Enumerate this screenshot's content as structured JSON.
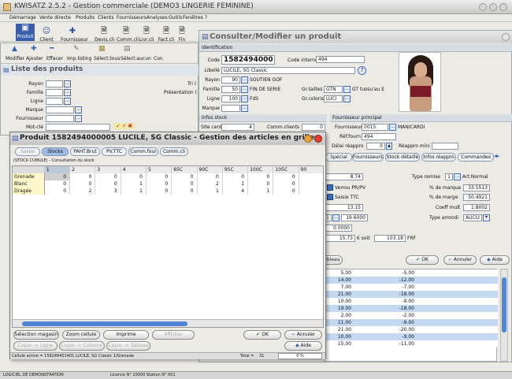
{
  "app": {
    "title": "KWISATZ 2.5.2 - Gestion commerciale (DEMO3 LINGERIE FEMININE)"
  },
  "menu": [
    "Démarrage",
    "Vente directe",
    "Produits",
    "Clients",
    "Fournisseurs",
    "Analyses",
    "Outils",
    "Fenêtres",
    "?"
  ],
  "toolbar": [
    "Produit",
    "Client",
    "Fournisseur",
    "Devis.cli",
    "Comm.cli",
    "Livr.cli",
    "Fact.cli",
    "Fin"
  ],
  "toolbar2": [
    "Modifier",
    "Ajouter",
    "Effacer",
    "Imp.listing",
    "Sélect.tous",
    "Sélect.aucun",
    "Con"
  ],
  "listing": {
    "title": "Liste des produits",
    "filters": [
      "Rayon",
      "Famille",
      "Ligne",
      "Marque",
      "Fournisseur",
      "Mot-clé"
    ],
    "right1": "Tri (",
    "right2": "Présentation ("
  },
  "consult": {
    "title": "Consulter/Modifier un produit",
    "ident_header": "Identification",
    "code_label": "Code",
    "code_value": "1582494000005",
    "code_interne_label": "Code interne",
    "code_interne_value": "494",
    "libelle_label": "Libellé",
    "libelle_value": "LUCILE, SG Classic",
    "rayon_label": "Rayon",
    "rayon_code": "90",
    "rayon_name": "SOUTIEN GOF",
    "famille_label": "Famille",
    "famille_code": "50",
    "famille_name": "FIN DE SERIE",
    "ligne_label": "Ligne",
    "ligne_code": "100",
    "ligne_name": "FdS",
    "marque_label": "Marque",
    "grtailles_label": "Gr.tailles",
    "grtailles_value": "GTN",
    "grtailles_name": "GT tussu'au E",
    "grcolors_label": "Gr.coloris",
    "grcolors_value": "LUCI",
    "stock_header": "Infos stock",
    "stock_central_label": "Site central",
    "stock_central_value": "4",
    "comm_clients_label": "Comm.clients",
    "comm_clients_value": "0",
    "fourn_header": "Fournisseur principal",
    "fourn_label": "Fournisseur",
    "fourn_code": "0015",
    "fourn_name": "MANICARDI",
    "ref_four_label": "Réf.fourn",
    "ref_four_value": "494",
    "delai_label": "Délai réappro",
    "delai_value": "0",
    "reappro_label": "Réappro mini",
    "tabs": [
      "Spécial",
      "Fournisseurs",
      "Stock détaillé",
      "Infos réappro",
      "Commandes"
    ],
    "vals": [
      "8.74",
      "13.15",
      "19.6000",
      "0.0000",
      "15.73",
      "103.18"
    ],
    "verrou_label": "Verrou PR/PV",
    "saisie_ttc_label": "Saisie TTC",
    "qty_one": "1",
    "euro_soit": "€ soit",
    "frf": "FRF",
    "type_remise_label": "Type remise",
    "type_remise_num": "1",
    "type_remise_value": "Art.Normal",
    "marque_pct_label": "% de marque",
    "marque_pct_value": "33.5513",
    "marge_pct_label": "% de marge",
    "marge_pct_value": "50.4921",
    "coeff_label": "Coeff mult",
    "coeff_value": "1.8002",
    "arrondi_label": "Type arrondi",
    "arrondi_value": "AUCUN",
    "tableau_label": "Tableau",
    "ok_label": "OK",
    "annuler_label": "Annuler",
    "aide_label": "Aide",
    "list_rows": [
      [
        "5.00",
        "-5.00"
      ],
      [
        "14.00",
        "-12.00"
      ],
      [
        "7.00",
        "-7.00"
      ],
      [
        "21.00",
        "-18.00"
      ],
      [
        "10.00",
        "-9.00"
      ],
      [
        "19.00",
        "-18.00"
      ],
      [
        "2.00",
        "-2.00"
      ],
      [
        "11.00",
        "-9.00"
      ],
      [
        "21.00",
        "-20.00"
      ],
      [
        "10.00",
        "-9.00"
      ],
      [
        "15.00",
        "-11.00"
      ]
    ]
  },
  "grid": {
    "title": "Produit 1582494000005 LUCILE, SG Classic - Gestion des articles en grilles",
    "tabs": [
      "Saisie",
      "Stocks",
      "PAHT.Brut",
      "PV.TTC",
      "Comm.four",
      "Comm.cli"
    ],
    "caption": "(STOCK CUMULE) - Consultation du stock",
    "columns": [
      "",
      "1",
      "2",
      "3",
      "4",
      "5",
      "85C",
      "90C",
      "95C",
      "100C",
      "105C",
      "90"
    ],
    "rows": [
      {
        "name": "Grenade",
        "vals": [
          "0",
          "0",
          "0",
          "0",
          "0",
          "0",
          "0",
          "0",
          "0",
          "0"
        ]
      },
      {
        "name": "Blanc",
        "vals": [
          "0",
          "0",
          "0",
          "1",
          "0",
          "0",
          "2",
          "1",
          "0",
          "0"
        ]
      },
      {
        "name": "Dragée",
        "vals": [
          "0",
          "2",
          "3",
          "1",
          "0",
          "0",
          "1",
          "4",
          "1",
          "0"
        ]
      }
    ],
    "buttons": [
      "Sélection magasin",
      "Zoom cellule",
      "Imprime",
      "Afficher"
    ],
    "buttons2": [
      "Copie -> Ligne",
      "Copie -> Colonne",
      "Copie -> Tableau"
    ],
    "ok_label": "OK",
    "annuler_label": "Annuler",
    "aide_label": "Aide",
    "status_left": "Cellule active = 158249401401 LUCILE, SG Classic 1/Grenade",
    "total_label": "Total =",
    "total_value": "31",
    "pct": "0 %"
  },
  "status": [
    "LOGICIEL DE DEMONSTRATION",
    "Licence N° 10000 Station N° 001"
  ]
}
